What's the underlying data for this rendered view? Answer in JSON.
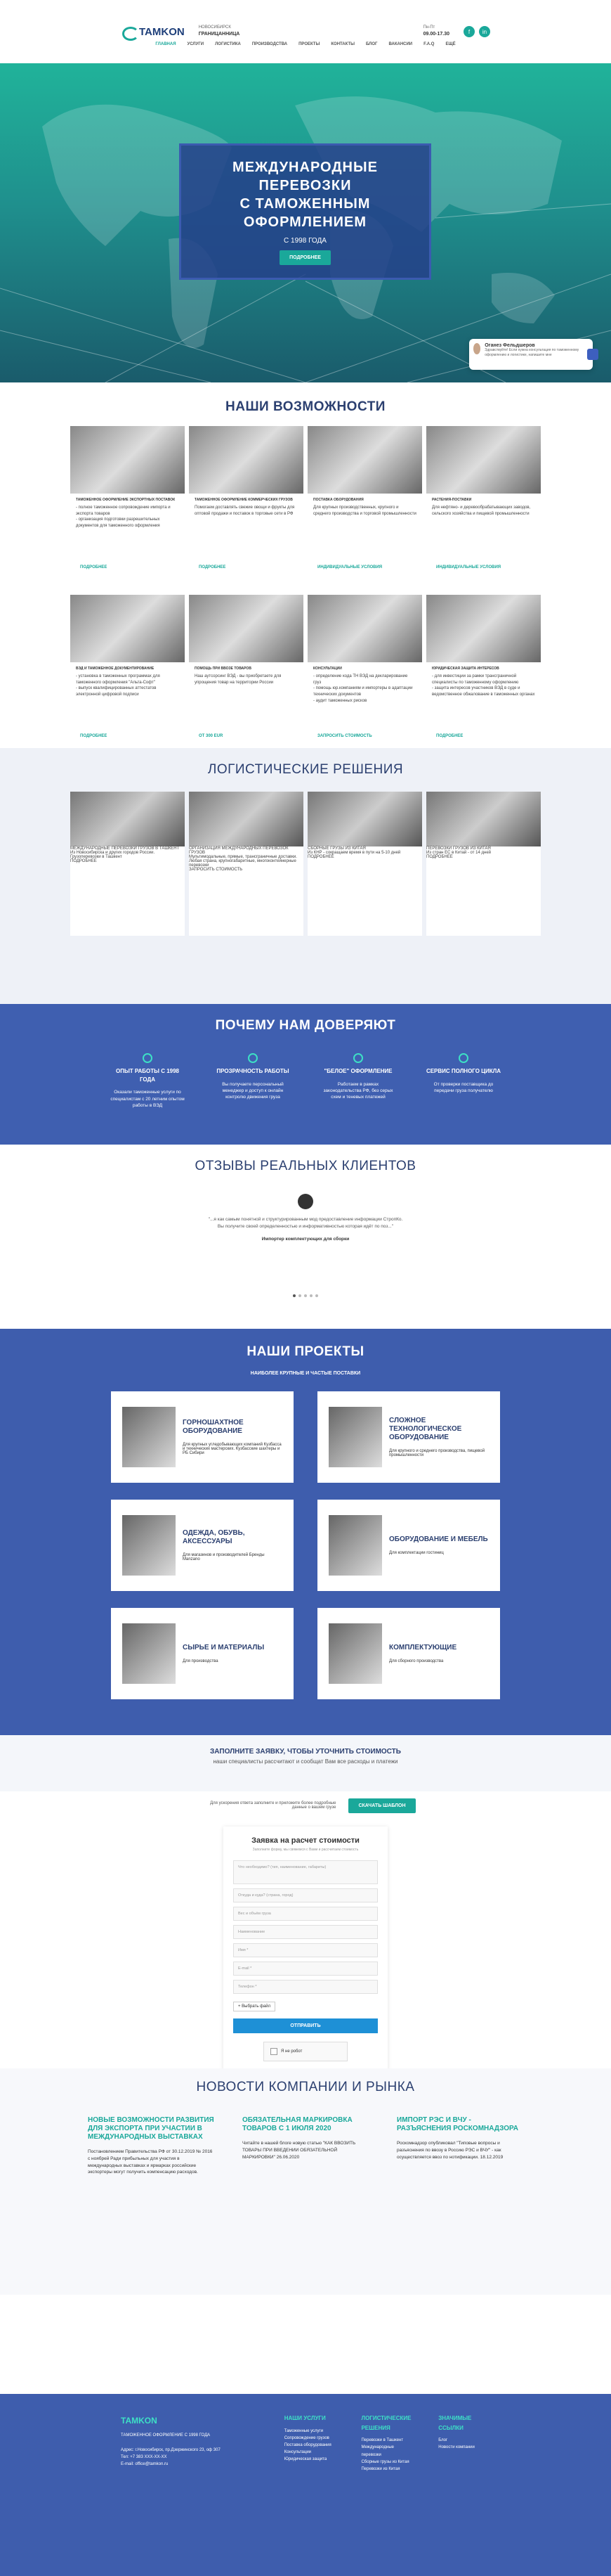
{
  "header": {
    "logo": "TAMKON",
    "region_label": "НОВОСИБИРСК",
    "region_sub": "ГРАНИЦАННИЦА",
    "phone_label": "Пн-Пт",
    "hours": "09.00-17.30",
    "social": [
      "f",
      "in"
    ]
  },
  "nav": [
    "ГЛАВНАЯ",
    "УСЛУГИ",
    "ЛОГИСТИКА",
    "ПРОИЗВОДСТВА",
    "ПРОЕКТЫ",
    "КОНТАКТЫ",
    "БЛОГ",
    "ВАКАНСИИ",
    "F.A.Q",
    "ЕЩЁ"
  ],
  "hero": {
    "title_lines": [
      "МЕЖДУНАРОДНЫЕ",
      "ПЕРЕВОЗКИ",
      "С ТАМОЖЕННЫМ",
      "ОФОРМЛЕНИЕМ"
    ],
    "since": "С 1998 ГОДА",
    "button": "ПОДРОБНЕЕ"
  },
  "chat": {
    "name": "Оганез Фельдшеров",
    "text": "Здравствуйте! Если нужна консультация по таможенному оформлению и логистике, напишите мне"
  },
  "opportunities": {
    "title": "НАШИ ВОЗМОЖНОСТИ",
    "cards": [
      {
        "cat": "ТАМОЖЕННОЕ ОФОРМЛЕНИЕ ЭКСПОРТНЫХ ПОСТАВОК",
        "text": "- полное таможенное сопровождение импорта и экспорта товаров\n- организация подготовки разрешительных документов для таможенного оформления",
        "link": "ПОДРОБНЕЕ"
      },
      {
        "cat": "ТАМОЖЕННОЕ ОФОРМЛЕНИЕ КОММЕРЧЕСКИХ ГРУЗОВ",
        "text": "Помогаем доставлять свежие овощи и фрукты для оптовой продажи и поставок в торговые сети в РФ",
        "link": "ПОДРОБНЕЕ"
      },
      {
        "cat": "ПОСТАВКА ОБОРУДОВАНИЯ",
        "text": "Для крупных производственных, крупного и среднего производства и торговой промышленности",
        "link": "ИНДИВИДУАЛЬНЫЕ УСЛОВИЯ"
      },
      {
        "cat": "РАСТЕНИЯ-ПОСТАВКИ",
        "text": "Для нефтяно- и деревообрабатывающих заводов, сельского хозяйства и пищевой промышленности",
        "link": "ИНДИВИДУАЛЬНЫЕ УСЛОВИЯ"
      },
      {
        "cat": "ВЭД И ТАМОЖЕННОЕ ДОКУМЕНТИРОВАНИЕ",
        "text": "- установка в таможенных программах для таможенного оформления \"Альта-Софт\"\n- выпуск квалифицированных аттестатов электронной цифровой подписи",
        "link": "ПОДРОБНЕЕ"
      },
      {
        "cat": "ПОМОЩЬ ПРИ ВВОЗЕ ТОВАРОВ",
        "text": "Наш аутсорсинг ВЭД - вы приобретаете для упрощения товар на территории России",
        "link": "ОТ 300 EUR"
      },
      {
        "cat": "КОНСУЛЬТАЦИИ",
        "text": "- определение кода ТН ВЭД на декларирование груз\n- помощь юр.компаниям и импортеры в адаптации технических документов\n- аудит таможенных рисков",
        "link": "ЗАПРОСИТЬ СТОИМОСТЬ"
      },
      {
        "cat": "ЮРИДИЧЕСКАЯ ЗАЩИТА ИНТЕРЕСОВ",
        "text": "- для инвестиции за рамки трансграничной специалисты по таможенному оформлению\n- защита интересов участников ВЭД в суде и ведомственное обжалование в таможенных органах",
        "link": "ПОДРОБНЕЕ"
      }
    ]
  },
  "logistics": {
    "title": "ЛОГИСТИЧЕСКИЕ РЕШЕНИЯ",
    "cards": [
      {
        "cat": "МЕЖДУНАРОДНЫЕ ПЕРЕВОЗКИ ГРУЗОВ В ТАШКЕНТ",
        "text": "Из Новосибирска и других городов России. Грузоперевозки в Ташкент",
        "link": "ПОДРОБНЕЕ"
      },
      {
        "cat": "ОРГАНИЗАЦИЯ МЕЖДУНАРОДНЫХ ПЕРЕВОЗОК ГРУЗОВ",
        "text": "Мультимодальные, прямые, трансграничные доставки. Любая страна, крупногабаритные, многоконтейнерные перевозки",
        "link": "ЗАПРОСИТЬ СТОИМОСТЬ"
      },
      {
        "cat": "СБОРНЫЕ ГРУЗЫ ИЗ КИТАЯ",
        "text": "Из КНР - сокращаем время в пути на 5-10 дней",
        "link": "ПОДРОБНЕЕ"
      },
      {
        "cat": "ПЕРЕВОЗКИ ГРУЗОВ ИЗ КИТАЯ",
        "text": "Из стран ЕС в Китай - от 14 дней",
        "link": "ПОДРОБНЕЕ"
      }
    ]
  },
  "trust": {
    "title": "ПОЧЕМУ НАМ ДОВЕРЯЮТ",
    "items": [
      {
        "title": "ОПЫТ РАБОТЫ С 1998 ГОДА",
        "text": "Оказали таможенные услуги по специалистам с 20 летним опытом работы в ВЭД"
      },
      {
        "title": "ПРОЗРАЧНОСТЬ РАБОТЫ",
        "text": "Вы получаете персональный менеджер и доступ к онлайн контролю движения груза"
      },
      {
        "title": "\"БЕЛОЕ\" ОФОРМЛЕНИЕ",
        "text": "Работаем в рамках законодательства РФ, без серых схем и теневых платежей"
      },
      {
        "title": "СЕРВИС ПОЛНОГО ЦИКЛА",
        "text": "От проверки поставщика до передачи груза получателю"
      }
    ]
  },
  "reviews": {
    "title": "ОТЗЫВЫ РЕАЛЬНЫХ КЛИЕНТОВ",
    "quote": "\"...я как самым понятной и структурированным мод предоставление информации СтропКо. Вы получите своей определенностью и информативностью которая идёт по поз...\"",
    "author": "Импортер комплектующих для сборки"
  },
  "projects": {
    "title": "НАШИ ПРОЕКТЫ",
    "subtitle": "НАИБОЛЕЕ КРУПНЫЕ И ЧАСТЫЕ ПОСТАВКИ",
    "items": [
      {
        "title": "ГОРНОШАХТНОЕ ОБОРУДОВАНИЕ",
        "text": "Для крупных угледобывающих компаний Кузбасса и технических мастерских. Кузбасские шахтеры и РБ Сибири"
      },
      {
        "title": "СЛОЖНОЕ ТЕХНОЛОГИЧЕСКОЕ ОБОРУДОВАНИЕ",
        "text": "Для крупного и среднего производства, пищевой промышленности"
      },
      {
        "title": "ОДЕЖДА, ОБУВЬ, АКСЕССУАРЫ",
        "text": "Для магазинов и производителей Бренды Manzano"
      },
      {
        "title": "ОБОРУДОВАНИЕ И МЕБЕЛЬ",
        "text": "Для комплектации гостиниц"
      },
      {
        "title": "СЫРЬЕ И МАТЕРИАЛЫ",
        "text": "Для производства"
      },
      {
        "title": "КОМПЛЕКТУЮЩИЕ",
        "text": "Для сборного производства"
      }
    ]
  },
  "cta": {
    "title": "ЗАПОЛНИТЕ ЗАЯВКУ, ЧТОБЫ УТОЧНИТЬ СТОИМОСТЬ",
    "subtitle": "наши специалисты рассчитают и сообщат Вам все расходы и платежи",
    "text": "Для ускорения ответа заполните и приложите более подробные данные о вашем грузе",
    "button": "СКАЧАТЬ ШАБЛОН"
  },
  "form": {
    "title": "Заявка на расчет стоимости",
    "subtitle": "Заполните форму, мы свяжемся с Вами и рассчитаем стоимость",
    "fields": [
      "Что необходимо? (тип, наименование, габариты)",
      "Откуда и куда? (страна, город)",
      "Вес и объём груза",
      "Наименование",
      "Имя *",
      "E-mail *",
      "Телефон *"
    ],
    "file_label": "+ Выбрать файл",
    "submit": "ОТПРАВИТЬ",
    "captcha": "Я не робот"
  },
  "news": {
    "title": "НОВОСТИ КОМПАНИИ И РЫНКА",
    "items": [
      {
        "title": "НОВЫЕ ВОЗМОЖНОСТИ РАЗВИТИЯ ДЛЯ ЭКСПОРТА ПРИ УЧАСТИИ В МЕЖДУНАРОДНЫХ ВЫСТАВКАХ",
        "text": "Постановлением Правительства РФ от 30.12.2019 № 2016 с ноябрей Ради прибыльных для участия в международных выставках и ярмарках российские экспортеры могут получить компенсацию расходов."
      },
      {
        "title": "ОБЯЗАТЕЛЬНАЯ МАРКИРОВКА ТОВАРОВ С 1 ИЮЛЯ 2020",
        "text": "Читайте в нашей блоге новую статью \"КАК ВВОЗИТЬ ТОВАРЫ ПРИ ВВЕДЕНИИ ОБЯЗАТЕЛЬНОЙ МАРКИРОВКИ\" 26.06.2020"
      },
      {
        "title": "ИМПОРТ РЭС И ВЧУ - РАЗЪЯСНЕНИЯ РОСКОМНАДЗОРА",
        "text": "Роскомнадзор опубликовал \"Типовые вопросы и разъяснения по ввозу в Россию РЭС и ВЧУ\" - как осуществляется ввоз по нотификации. 18.12.2019"
      }
    ]
  },
  "footer": {
    "logo": "TAMKON",
    "company": "ТАМОЖЕННОЕ ОФОРМЛЕНИЕ С 1998 ГОДА",
    "address": "Адрес: г.Новосибирск, пр.Дзержинского 23, оф 307",
    "phone": "Тел: +7 383 XXX-XX-XX",
    "email": "E-mail: office@tamkon.ru",
    "col1_title": "НАШИ УСЛУГИ",
    "col1": [
      "Таможенные услуги",
      "Сопровождение грузов",
      "Поставка оборудования",
      "Консультации",
      "Юридическая защита"
    ],
    "col2_title": "ЛОГИСТИЧЕСКИЕ РЕШЕНИЯ",
    "col2": [
      "Перевозки в Ташкент",
      "Международные перевозки",
      "Сборные грузы из Китая",
      "Перевозки из Китая"
    ],
    "col3_title": "ЗНАЧИМЫЕ ССЫЛКИ",
    "col3": [
      "Блог",
      "Новости компании"
    ]
  }
}
